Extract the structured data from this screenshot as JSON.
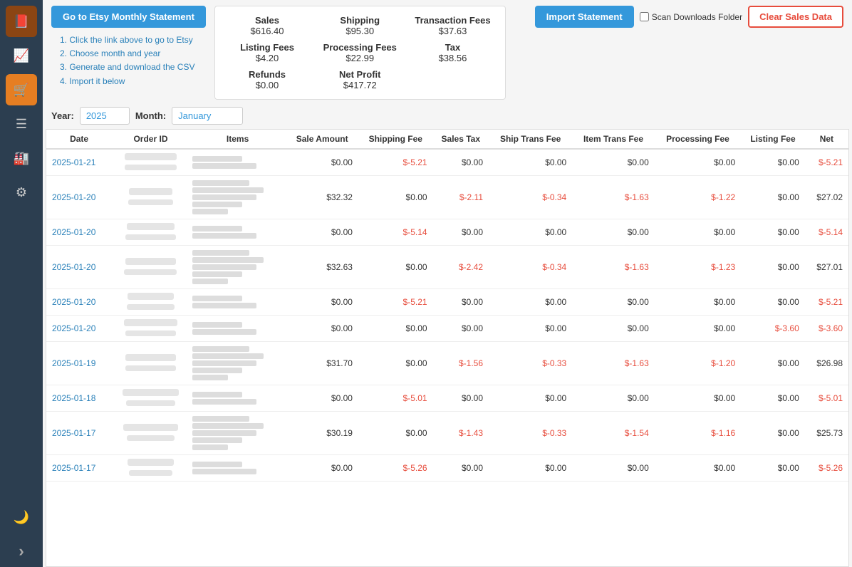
{
  "sidebar": {
    "items": [
      {
        "id": "book",
        "icon": "📕",
        "active": false
      },
      {
        "id": "chart",
        "icon": "📈",
        "active": false
      },
      {
        "id": "cart",
        "icon": "🛒",
        "active": true
      },
      {
        "id": "list",
        "icon": "☰",
        "active": false
      },
      {
        "id": "warehouse",
        "icon": "🏭",
        "active": false
      },
      {
        "id": "settings",
        "icon": "⚙",
        "active": false
      },
      {
        "id": "moon",
        "icon": "🌙",
        "active": false
      },
      {
        "id": "arrow",
        "icon": "›",
        "active": false
      }
    ]
  },
  "header": {
    "go_monthly_label": "Go to Etsy Monthly Statement",
    "import_label": "Import Statement",
    "clear_label": "Clear Sales Data",
    "scan_label": "Scan Downloads Folder",
    "instructions": [
      "1. Click the link above to go to Etsy",
      "2. Choose month and year",
      "3. Generate and download the CSV",
      "4. Import it below"
    ]
  },
  "summary": {
    "sales_label": "Sales",
    "sales_value": "$616.40",
    "shipping_label": "Shipping",
    "shipping_value": "$95.30",
    "transaction_fees_label": "Transaction Fees",
    "transaction_fees_value": "$37.63",
    "listing_fees_label": "Listing Fees",
    "listing_fees_value": "$4.20",
    "processing_fees_label": "Processing Fees",
    "processing_fees_value": "$22.99",
    "tax_label": "Tax",
    "tax_value": "$38.56",
    "refunds_label": "Refunds",
    "refunds_value": "$0.00",
    "net_profit_label": "Net Profit",
    "net_profit_value": "$417.72"
  },
  "filter": {
    "year_label": "Year:",
    "year_value": "2025",
    "month_label": "Month:",
    "month_value": "January"
  },
  "table": {
    "headers": [
      "Date",
      "Order ID",
      "Items",
      "Sale Amount",
      "Shipping Fee",
      "Sales Tax",
      "Ship Trans Fee",
      "Item Trans Fee",
      "Processing Fee",
      "Listing Fee",
      "Net"
    ],
    "rows": [
      {
        "date": "2025-01-21",
        "sale": "$0.00",
        "shipping_fee": "$-5.21",
        "sales_tax": "$0.00",
        "ship_trans": "$0.00",
        "item_trans": "$0.00",
        "proc_fee": "$0.00",
        "listing_fee": "$0.00",
        "net": "$-5.21",
        "net_neg": true,
        "ship_neg": true
      },
      {
        "date": "2025-01-20",
        "sale": "$32.32",
        "shipping_fee": "$0.00",
        "sales_tax": "$-2.11",
        "ship_trans": "$-0.34",
        "item_trans": "$-1.63",
        "proc_fee": "$-1.22",
        "listing_fee": "$0.00",
        "net": "$27.02",
        "net_neg": false,
        "tax_neg": true,
        "st_neg": true,
        "it_neg": true,
        "pf_neg": true
      },
      {
        "date": "2025-01-20",
        "sale": "$0.00",
        "shipping_fee": "$-5.14",
        "sales_tax": "$0.00",
        "ship_trans": "$0.00",
        "item_trans": "$0.00",
        "proc_fee": "$0.00",
        "listing_fee": "$0.00",
        "net": "$-5.14",
        "net_neg": true,
        "ship_neg": true
      },
      {
        "date": "2025-01-20",
        "sale": "$32.63",
        "shipping_fee": "$0.00",
        "sales_tax": "$-2.42",
        "ship_trans": "$-0.34",
        "item_trans": "$-1.63",
        "proc_fee": "$-1.23",
        "listing_fee": "$0.00",
        "net": "$27.01",
        "net_neg": false,
        "tax_neg": true,
        "st_neg": true,
        "it_neg": true,
        "pf_neg": true
      },
      {
        "date": "2025-01-20",
        "sale": "$0.00",
        "shipping_fee": "$-5.21",
        "sales_tax": "$0.00",
        "ship_trans": "$0.00",
        "item_trans": "$0.00",
        "proc_fee": "$0.00",
        "listing_fee": "$0.00",
        "net": "$-5.21",
        "net_neg": true,
        "ship_neg": true
      },
      {
        "date": "2025-01-20",
        "sale": "$0.00",
        "shipping_fee": "$0.00",
        "sales_tax": "$0.00",
        "ship_trans": "$0.00",
        "item_trans": "$0.00",
        "proc_fee": "$0.00",
        "listing_fee": "$-3.60",
        "net": "$-3.60",
        "net_neg": true,
        "lf_neg": true
      },
      {
        "date": "2025-01-19",
        "sale": "$31.70",
        "shipping_fee": "$0.00",
        "sales_tax": "$-1.56",
        "ship_trans": "$-0.33",
        "item_trans": "$-1.63",
        "proc_fee": "$-1.20",
        "listing_fee": "$0.00",
        "net": "$26.98",
        "net_neg": false,
        "tax_neg": true,
        "st_neg": true,
        "it_neg": true,
        "pf_neg": true
      },
      {
        "date": "2025-01-18",
        "sale": "$0.00",
        "shipping_fee": "$-5.01",
        "sales_tax": "$0.00",
        "ship_trans": "$0.00",
        "item_trans": "$0.00",
        "proc_fee": "$0.00",
        "listing_fee": "$0.00",
        "net": "$-5.01",
        "net_neg": true,
        "ship_neg": true
      },
      {
        "date": "2025-01-17",
        "sale": "$30.19",
        "shipping_fee": "$0.00",
        "sales_tax": "$-1.43",
        "ship_trans": "$-0.33",
        "item_trans": "$-1.54",
        "proc_fee": "$-1.16",
        "listing_fee": "$0.00",
        "net": "$25.73",
        "net_neg": false,
        "tax_neg": true,
        "st_neg": true,
        "it_neg": true,
        "pf_neg": true
      },
      {
        "date": "2025-01-17",
        "sale": "$0.00",
        "shipping_fee": "$-5.26",
        "sales_tax": "$0.00",
        "ship_trans": "$0.00",
        "item_trans": "$0.00",
        "proc_fee": "$0.00",
        "listing_fee": "$0.00",
        "net": "$-5.26",
        "net_neg": true,
        "ship_neg": true
      }
    ]
  }
}
